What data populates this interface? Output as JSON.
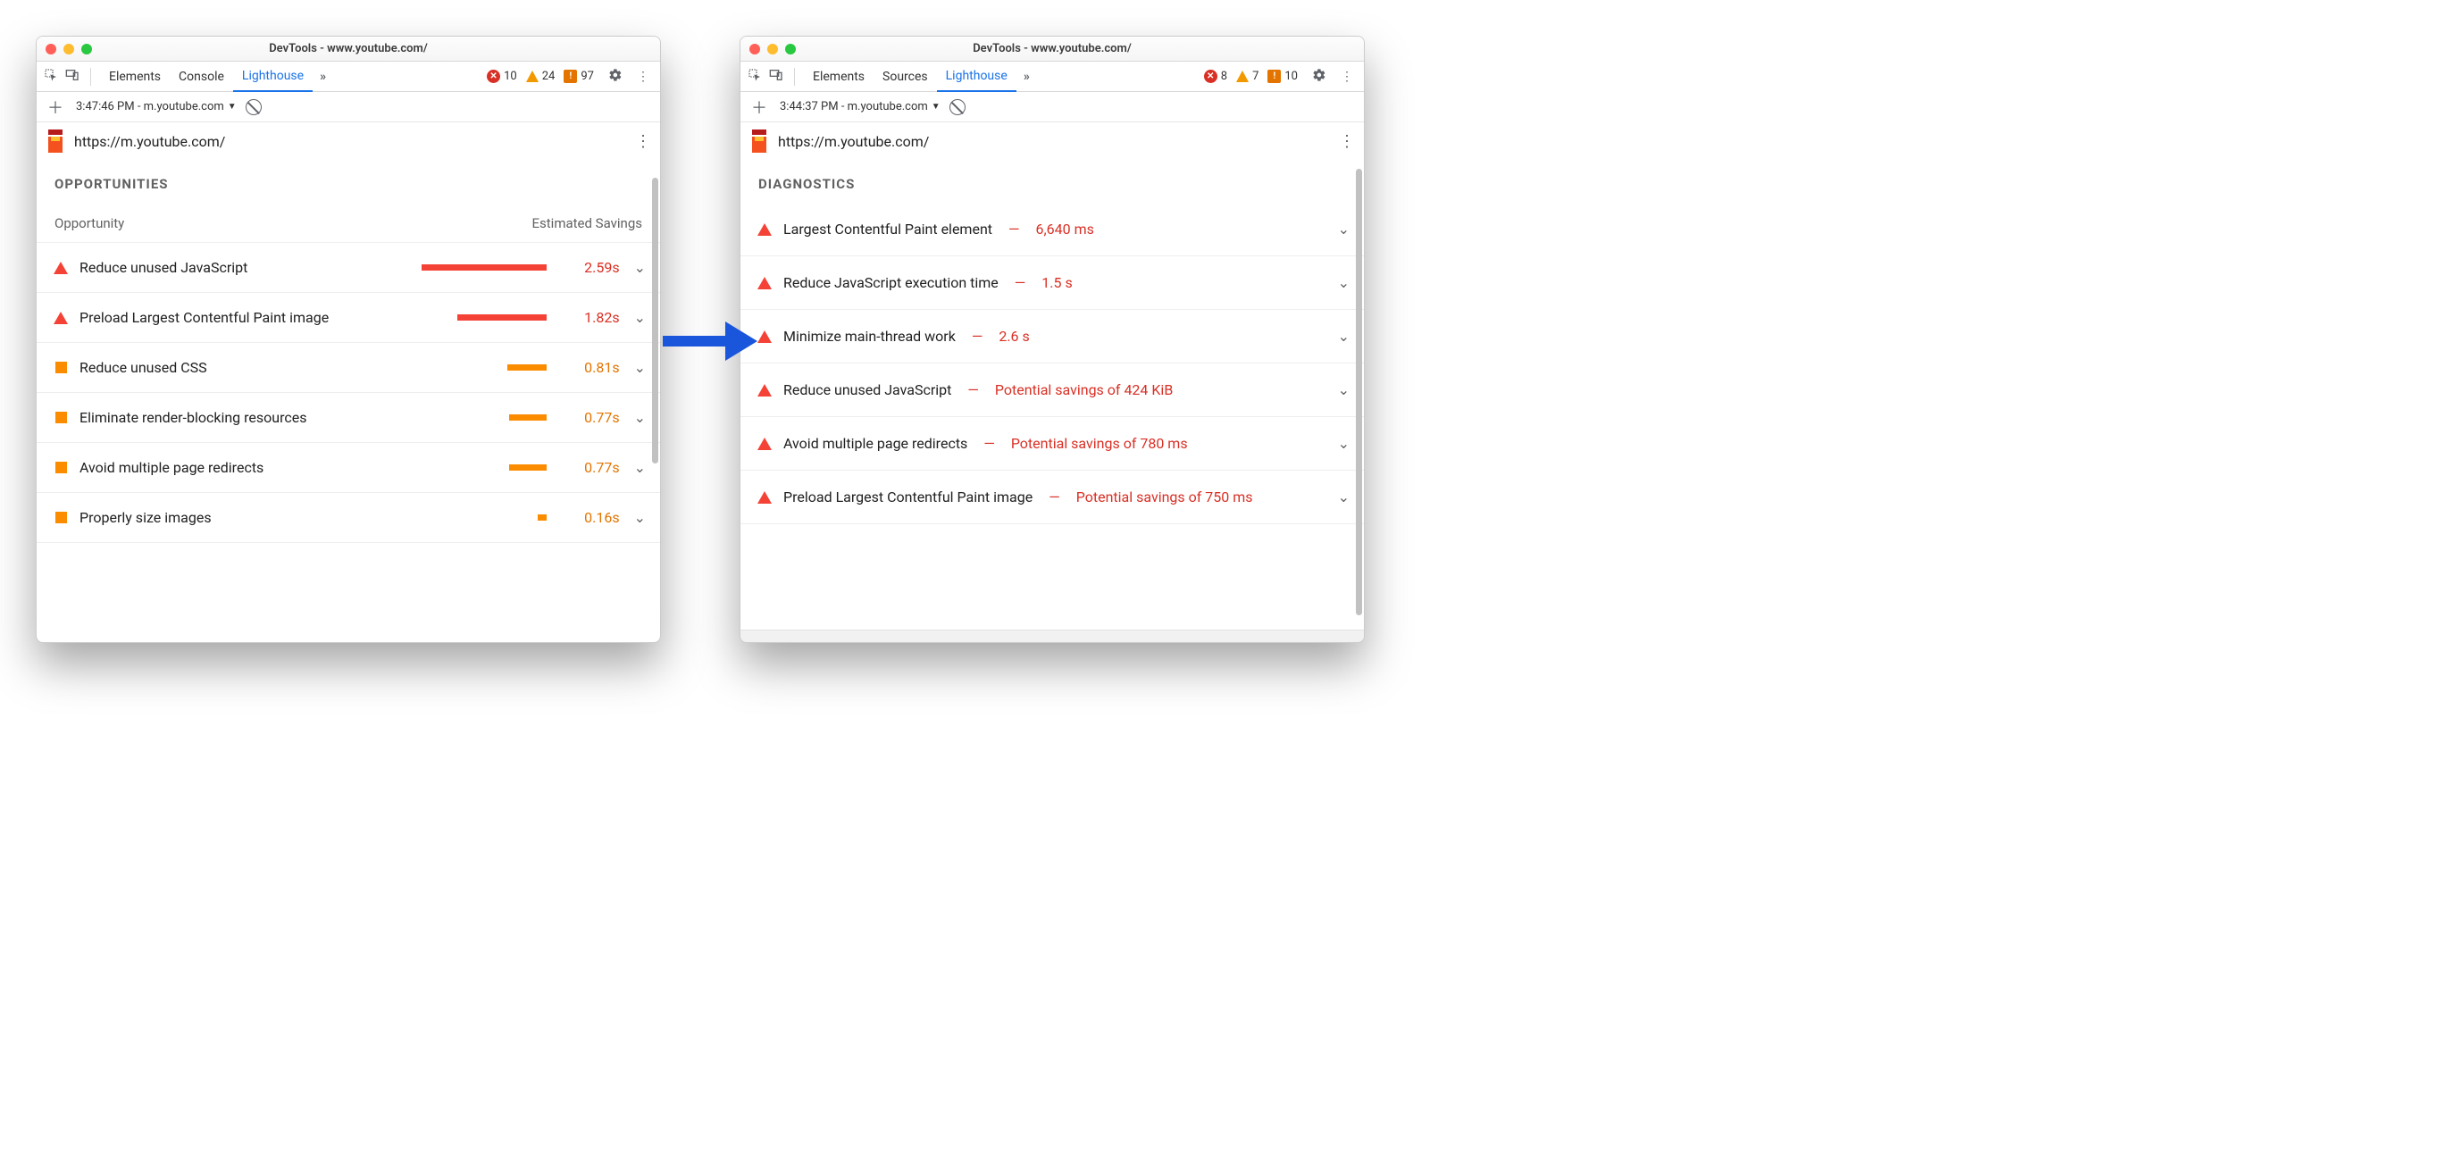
{
  "left": {
    "title": "DevTools - www.youtube.com/",
    "tabs": [
      "Elements",
      "Console",
      "Lighthouse"
    ],
    "activeTabIndex": 2,
    "badges": {
      "errors": "10",
      "warnings": "24",
      "info": "97"
    },
    "run": "3:47:46 PM - m.youtube.com",
    "url": "https://m.youtube.com/",
    "sectionTitle": "OPPORTUNITIES",
    "colLeft": "Opportunity",
    "colRight": "Estimated Savings",
    "rows": [
      {
        "sev": "red",
        "label": "Reduce unused JavaScript",
        "barColor": "red",
        "barW": 140,
        "val": "2.59s",
        "valClass": "red"
      },
      {
        "sev": "red",
        "label": "Preload Largest Contentful Paint image",
        "barColor": "red",
        "barW": 100,
        "val": "1.82s",
        "valClass": "red"
      },
      {
        "sev": "orange",
        "label": "Reduce unused CSS",
        "barColor": "orange",
        "barW": 44,
        "val": "0.81s",
        "valClass": "orange"
      },
      {
        "sev": "orange",
        "label": "Eliminate render-blocking resources",
        "barColor": "orange",
        "barW": 42,
        "val": "0.77s",
        "valClass": "orange"
      },
      {
        "sev": "orange",
        "label": "Avoid multiple page redirects",
        "barColor": "orange",
        "barW": 42,
        "val": "0.77s",
        "valClass": "orange"
      },
      {
        "sev": "orange",
        "label": "Properly size images",
        "barColor": "orange",
        "barW": 10,
        "val": "0.16s",
        "valClass": "orange"
      }
    ]
  },
  "right": {
    "title": "DevTools - www.youtube.com/",
    "tabs": [
      "Elements",
      "Sources",
      "Lighthouse"
    ],
    "activeTabIndex": 2,
    "badges": {
      "errors": "8",
      "warnings": "7",
      "info": "10"
    },
    "run": "3:44:37 PM - m.youtube.com",
    "url": "https://m.youtube.com/",
    "sectionTitle": "DIAGNOSTICS",
    "rows": [
      {
        "label": "Largest Contentful Paint element",
        "metric": "6,640 ms"
      },
      {
        "label": "Reduce JavaScript execution time",
        "metric": "1.5 s"
      },
      {
        "label": "Minimize main-thread work",
        "metric": "2.6 s"
      },
      {
        "label": "Reduce unused JavaScript",
        "metric": "Potential savings of 424 KiB"
      },
      {
        "label": "Avoid multiple page redirects",
        "metric": "Potential savings of 780 ms"
      },
      {
        "label": "Preload Largest Contentful Paint image",
        "metric": "Potential savings of 750 ms"
      }
    ]
  }
}
